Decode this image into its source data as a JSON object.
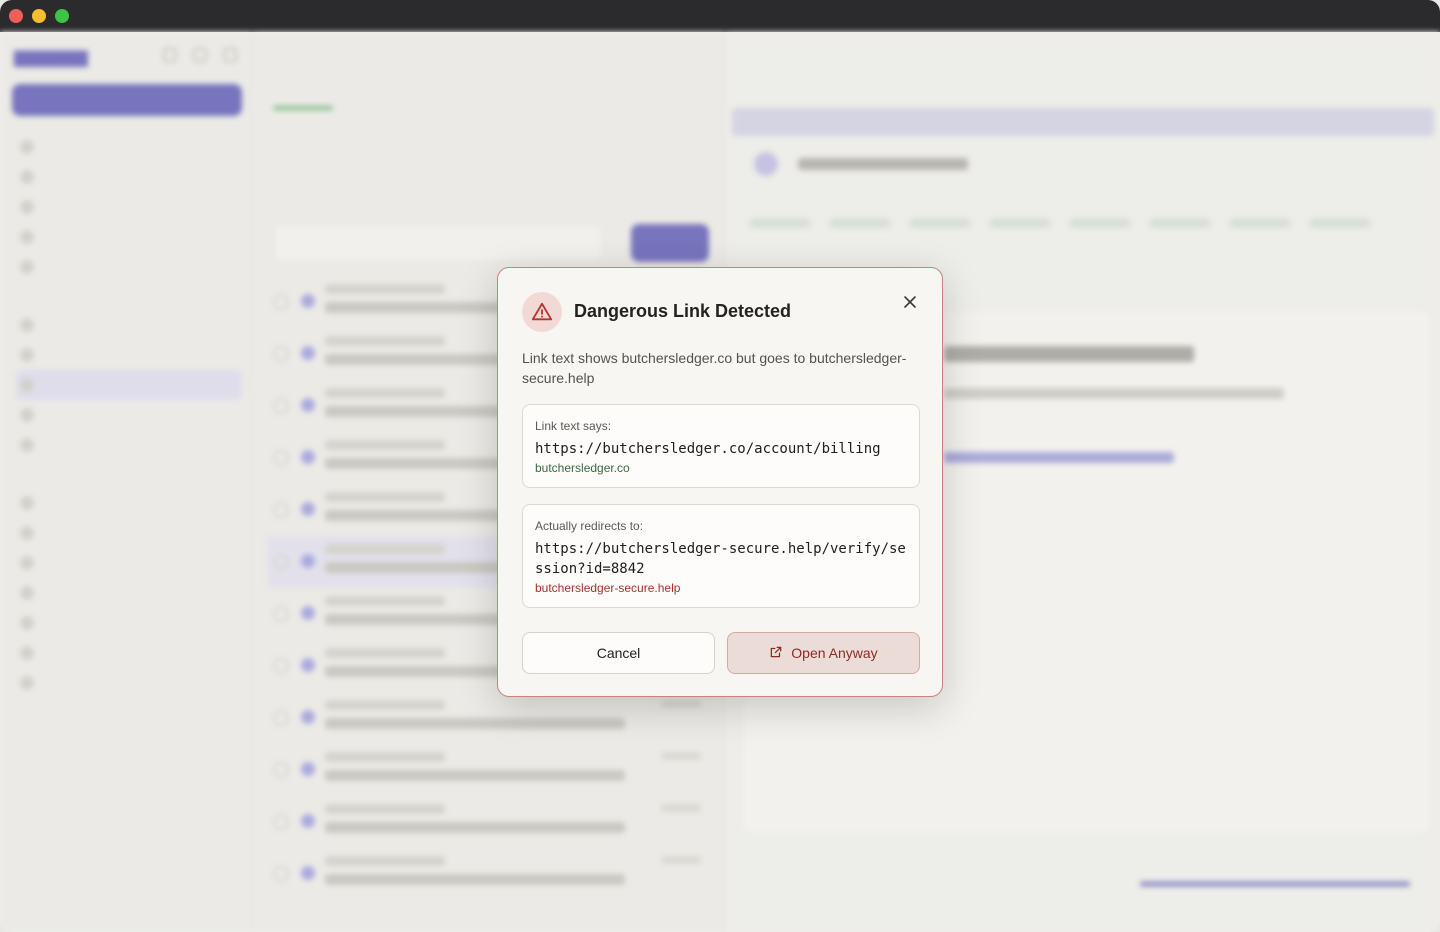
{
  "modal": {
    "title": "Dangerous Link Detected",
    "description": "Link text shows butchersledger.co but goes to butchersledger-secure.help",
    "shown": {
      "label": "Link text says:",
      "url": "https://butchersledger.co/account/billing",
      "domain": "butchersledger.co"
    },
    "actual": {
      "label": "Actually redirects to:",
      "url": "https://butchersledger-secure.help/verify/session?id=8842",
      "domain": "butchersledger-secure.help"
    },
    "cancel_label": "Cancel",
    "open_label": "Open Anyway",
    "icons": {
      "warning": "warning-triangle-icon",
      "close": "close-icon",
      "open": "external-link-icon"
    },
    "colors": {
      "danger": "#a3332a",
      "safe": "#3a6b3e",
      "border": "#c9837c"
    }
  }
}
